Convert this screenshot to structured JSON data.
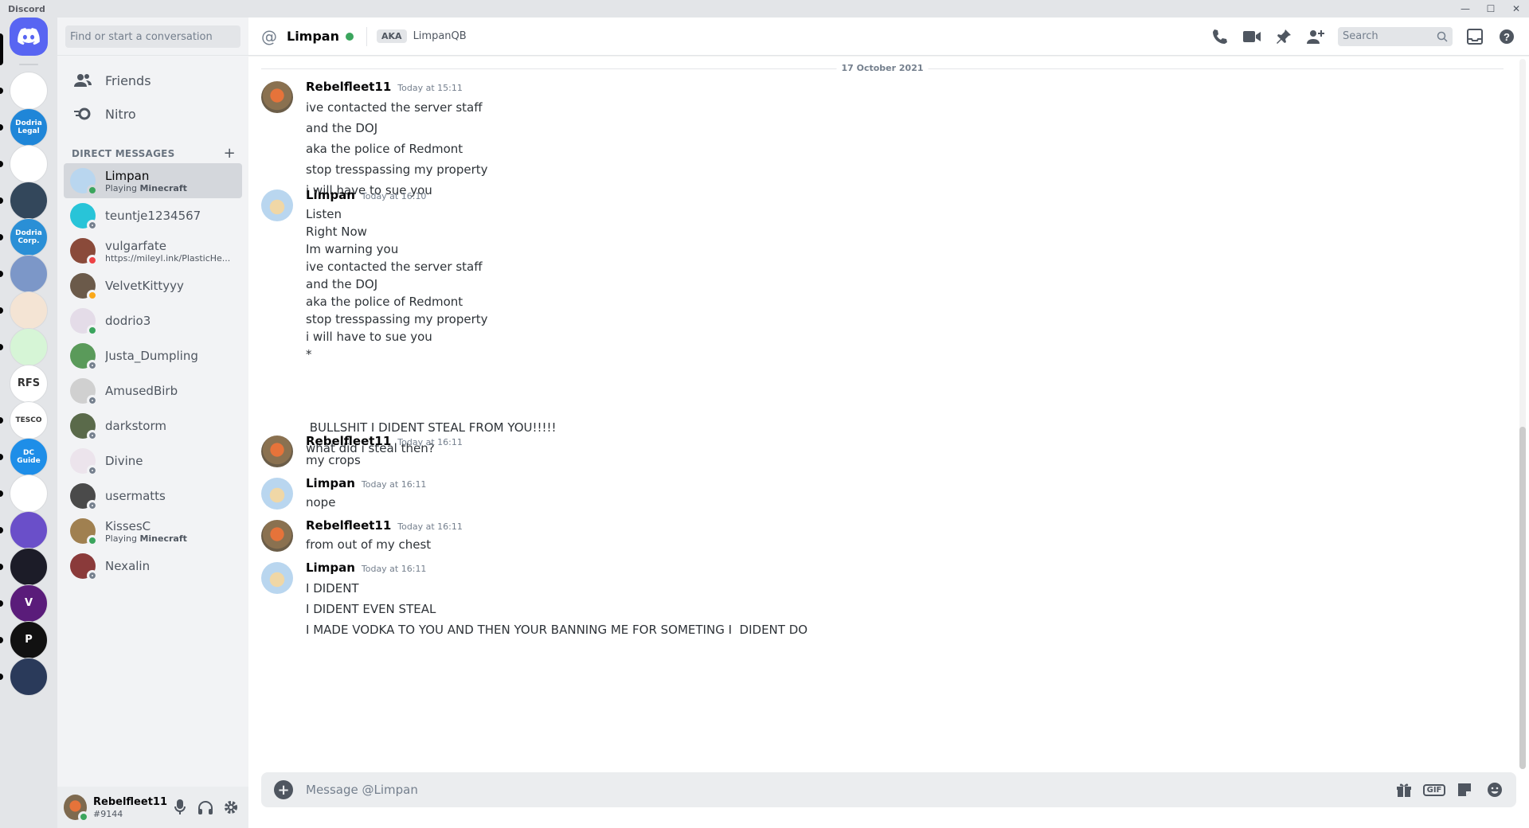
{
  "window": {
    "app_name": "Discord",
    "minimize": "—",
    "maximize": "☐",
    "close": "✕"
  },
  "guilds": [
    {
      "label": "",
      "bg": "#ffffff",
      "icon": "panda-icon"
    },
    {
      "label": "Dodria Legal",
      "bg": "#1f86d8",
      "icon": "dodria-legal-icon"
    },
    {
      "label": "",
      "bg": "#ffffff",
      "icon": "spark-icon"
    },
    {
      "label": "",
      "bg": "#33475b",
      "icon": "scales-icon"
    },
    {
      "label": "Dodria Corp.",
      "bg": "#2a8fd6",
      "icon": "dodria-corp-icon"
    },
    {
      "label": "",
      "bg": "#7c97c8",
      "icon": "triquetra-icon"
    },
    {
      "label": "",
      "bg": "#f4e4d4",
      "icon": "card-icon"
    },
    {
      "label": "",
      "bg": "#d6f5d6",
      "icon": "emerald-icon"
    },
    {
      "label": "RFS",
      "bg": "#ffffff",
      "icon": "rfs-icon"
    },
    {
      "label": "TESCO",
      "bg": "#ffffff",
      "icon": "tesco-icon"
    },
    {
      "label": "DC Guide",
      "bg": "#1e8ee8",
      "icon": "dc-guide-icon"
    },
    {
      "label": "",
      "bg": "#ffffff",
      "icon": "redhat-icon"
    },
    {
      "label": "",
      "bg": "#6a4fc9",
      "icon": "planet-icon"
    },
    {
      "label": "",
      "bg": "#1c1c28",
      "icon": "neon-icon"
    },
    {
      "label": "V",
      "bg": "#5a1c7a",
      "icon": "v-icon"
    },
    {
      "label": "P",
      "bg": "#111111",
      "icon": "p-icon"
    },
    {
      "label": "",
      "bg": "#2a3a5a",
      "icon": "triangle-icon"
    }
  ],
  "sidebar": {
    "search_placeholder": "Find or start a conversation",
    "friends_label": "Friends",
    "nitro_label": "Nitro",
    "dm_header": "DIRECT MESSAGES",
    "dms": [
      {
        "name": "Limpan",
        "sub_prefix": "Playing ",
        "sub_bold": "Minecraft",
        "status": "online",
        "color": "#b9d6ef",
        "active": true
      },
      {
        "name": "teuntje1234567",
        "sub_prefix": "",
        "sub_bold": "",
        "status": "offline",
        "color": "#28c4d8",
        "active": false
      },
      {
        "name": "vulgarfate",
        "sub_prefix": "https://mileyl.ink/PlasticHe...",
        "sub_bold": "",
        "status": "dnd",
        "color": "#8a4a3a",
        "active": false
      },
      {
        "name": "VelvetKittyyy",
        "sub_prefix": "",
        "sub_bold": "",
        "status": "idle",
        "color": "#6b5a4a",
        "active": false
      },
      {
        "name": "dodrio3",
        "sub_prefix": "",
        "sub_bold": "",
        "status": "online",
        "color": "#e4dce8",
        "active": false
      },
      {
        "name": "Justa_Dumpling",
        "sub_prefix": "",
        "sub_bold": "",
        "status": "offline",
        "color": "#5a9a5a",
        "active": false
      },
      {
        "name": "AmusedBirb",
        "sub_prefix": "",
        "sub_bold": "",
        "status": "offline",
        "color": "#d0d0d0",
        "active": false
      },
      {
        "name": "darkstorm",
        "sub_prefix": "",
        "sub_bold": "",
        "status": "offline",
        "color": "#5a6a4a",
        "active": false
      },
      {
        "name": "Divine",
        "sub_prefix": "",
        "sub_bold": "",
        "status": "offline",
        "color": "#ece4ec",
        "active": false
      },
      {
        "name": "usermatts",
        "sub_prefix": "",
        "sub_bold": "",
        "status": "offline",
        "color": "#4a4a4a",
        "active": false
      },
      {
        "name": "KissesC",
        "sub_prefix": "Playing ",
        "sub_bold": "Minecraft",
        "status": "online",
        "color": "#a08050",
        "active": false
      },
      {
        "name": "Nexalin",
        "sub_prefix": "",
        "sub_bold": "",
        "status": "offline",
        "color": "#8a3a3a",
        "active": false
      }
    ]
  },
  "user_panel": {
    "name": "Rebelfleet11",
    "tag": "#9144"
  },
  "topbar": {
    "channel_name": "Limpan",
    "aka_label": "AKA",
    "aka_value": "LimpanQB",
    "search_placeholder": "Search"
  },
  "chat": {
    "date_divider": "17 October 2021",
    "groups": [
      {
        "author": "Rebelfleet11",
        "time": "Today at 15:11",
        "avatar": "rebel",
        "lines": [
          "ive contacted the server staff",
          "and the DOJ",
          "aka the police of Redmont",
          "stop tresspassing my property",
          "i will have to sue you"
        ]
      },
      {
        "author": "Limpan",
        "time": "Today at 16:10",
        "avatar": "limpan",
        "lines": [
          "Listen",
          "Right Now",
          "Im warning you",
          "ive contacted the server staff",
          "and the DOJ",
          "aka the police of Redmont",
          "stop tresspassing my property",
          "i will have to sue you",
          "*",
          " BULLSHIT I DIDENT STEAL FROM YOU!!!!!",
          "what did i steal then?"
        ]
      },
      {
        "author": "Rebelfleet11",
        "time": "Today at 16:11",
        "avatar": "rebel",
        "lines": [
          "my crops"
        ]
      },
      {
        "author": "Limpan",
        "time": "Today at 16:11",
        "avatar": "limpan",
        "lines": [
          "nope"
        ]
      },
      {
        "author": "Rebelfleet11",
        "time": "Today at 16:11",
        "avatar": "rebel",
        "lines": [
          "from out of my chest"
        ]
      },
      {
        "author": "Limpan",
        "time": "Today at 16:11",
        "avatar": "limpan",
        "lines": [
          "I DIDENT",
          "I DIDENT EVEN STEAL",
          "I MADE VODKA TO YOU AND THEN YOUR BANNING ME FOR SOMETING I  DIDENT DO"
        ]
      }
    ]
  },
  "composer": {
    "placeholder": "Message @Limpan",
    "gif_label": "GIF"
  },
  "colors": {
    "blurple": "#5865f2",
    "online": "#3ba55d",
    "dnd": "#ed4245",
    "idle": "#faa81a"
  }
}
